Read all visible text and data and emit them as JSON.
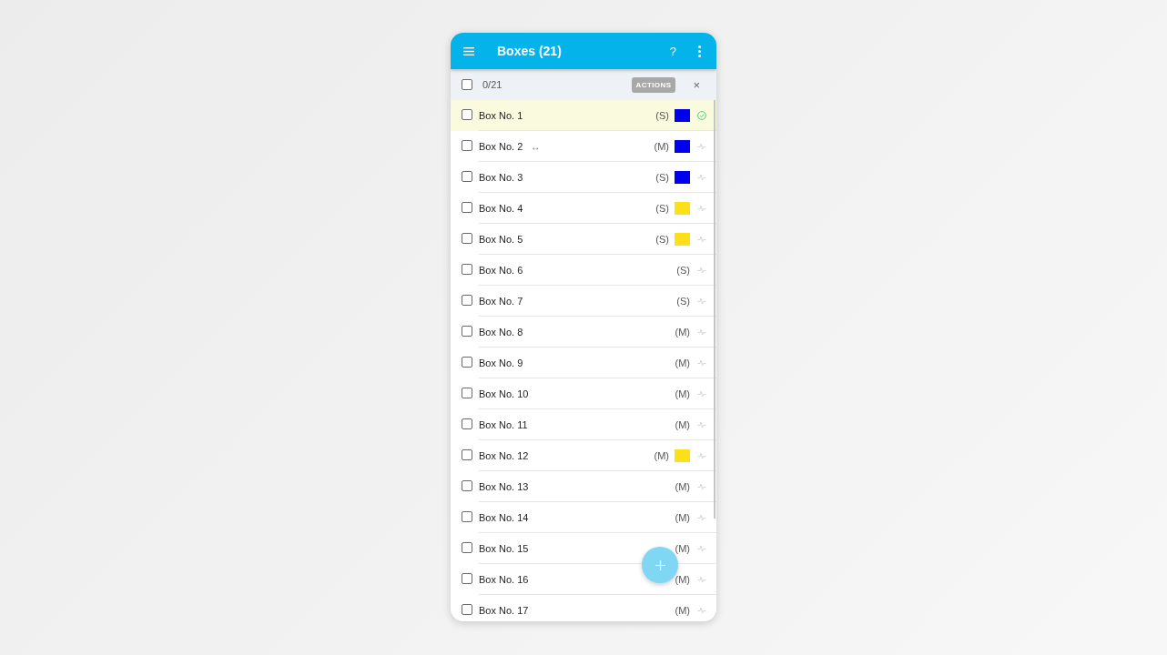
{
  "app_bar": {
    "title": "Boxes (21)",
    "help": "?"
  },
  "selection_bar": {
    "checked": false,
    "count": "0/21",
    "actions": "ACTIONS",
    "close": "×"
  },
  "rows": [
    {
      "label": "Box No. 1",
      "size": "(S)",
      "color": "#0000ee",
      "done": true,
      "checked": false,
      "selected": true
    },
    {
      "label": "Box No. 2",
      "handle": "↔",
      "size": "(M)",
      "color": "#0000ee",
      "done": false,
      "checked": false,
      "selected": false
    },
    {
      "label": "Box No. 3",
      "size": "(S)",
      "color": "#0000ee",
      "done": false,
      "checked": false,
      "selected": false
    },
    {
      "label": "Box No. 4",
      "size": "(S)",
      "color": "#fde01a",
      "done": false,
      "checked": false,
      "selected": false
    },
    {
      "label": "Box No. 5",
      "size": "(S)",
      "color": "#fde01a",
      "done": false,
      "checked": false,
      "selected": false
    },
    {
      "label": "Box No. 6",
      "size": "(S)",
      "done": false,
      "checked": false,
      "selected": false
    },
    {
      "label": "Box No. 7",
      "size": "(S)",
      "done": false,
      "checked": false,
      "selected": false
    },
    {
      "label": "Box No. 8",
      "size": "(M)",
      "done": false,
      "checked": false,
      "selected": false
    },
    {
      "label": "Box No. 9",
      "size": "(M)",
      "done": false,
      "checked": false,
      "selected": false
    },
    {
      "label": "Box No. 10",
      "size": "(M)",
      "done": false,
      "checked": false,
      "selected": false
    },
    {
      "label": "Box No. 11",
      "size": "(M)",
      "done": false,
      "checked": false,
      "selected": false
    },
    {
      "label": "Box No. 12",
      "size": "(M)",
      "color": "#fde01a",
      "done": false,
      "checked": false,
      "selected": false
    },
    {
      "label": "Box No. 13",
      "size": "(M)",
      "done": false,
      "checked": false,
      "selected": false
    },
    {
      "label": "Box No. 14",
      "size": "(M)",
      "done": false,
      "checked": false,
      "selected": false
    },
    {
      "label": "Box No. 15",
      "size": "(M)",
      "done": false,
      "checked": false,
      "selected": false
    },
    {
      "label": "Box No. 16",
      "size": "(M)",
      "done": false,
      "checked": false,
      "selected": false
    },
    {
      "label": "Box No. 17",
      "size": "(M)",
      "done": false,
      "checked": false,
      "selected": false
    }
  ]
}
